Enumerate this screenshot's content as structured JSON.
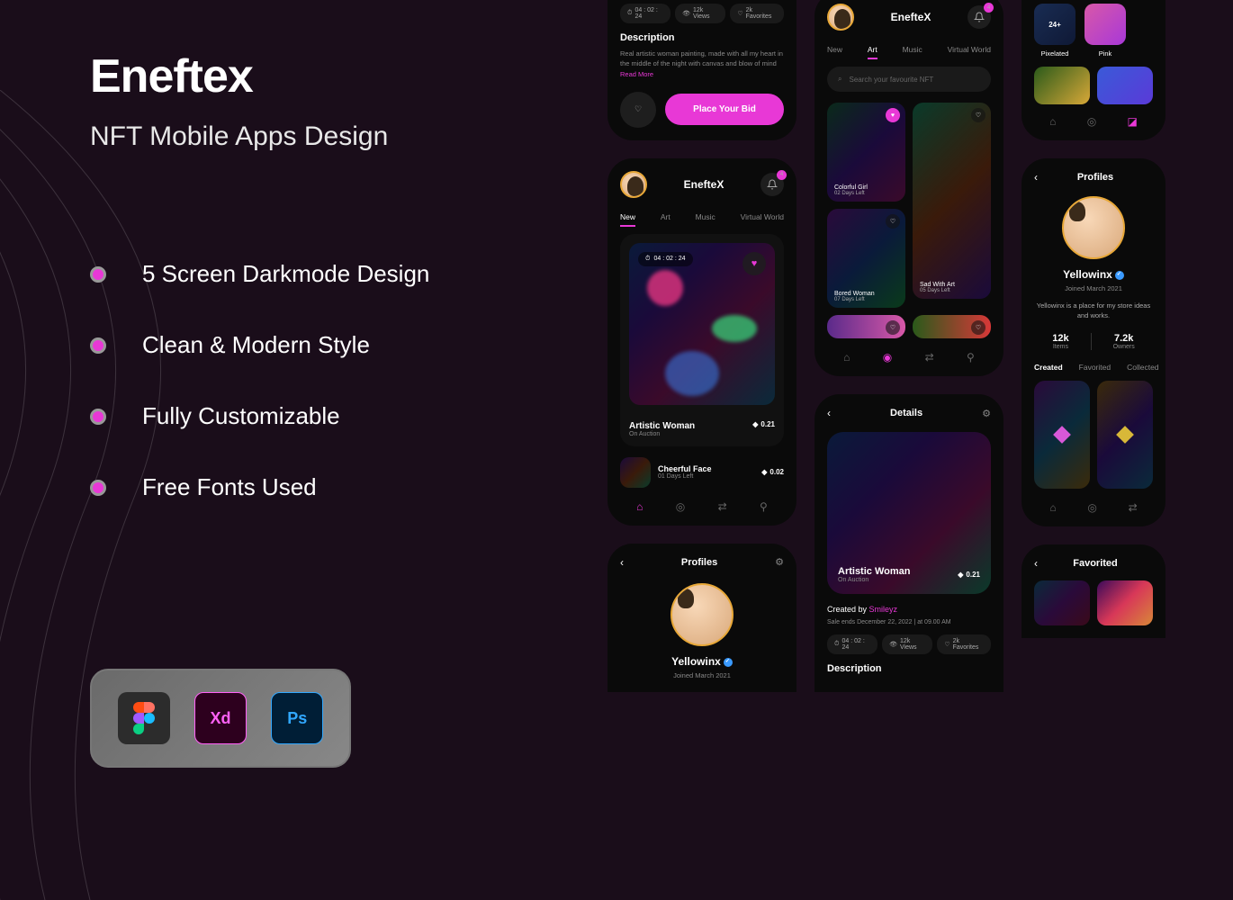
{
  "hero": {
    "title": "Eneftex",
    "subtitle": "NFT Mobile Apps Design",
    "features": [
      "5 Screen Darkmode Design",
      "Clean & Modern Style",
      "Fully Customizable",
      "Free Fonts Used"
    ],
    "tools": {
      "xd": "Xd",
      "ps": "Ps"
    }
  },
  "detail_top": {
    "time": "04 : 02 : 24",
    "views": "12k Views",
    "favs": "2k Favorites",
    "desc_title": "Description",
    "desc_text": "Real artistic woman painting, made with all my heart in the middle of the night with canvas and blow of mind ",
    "read_more": "Read More",
    "bid_button": "Place Your Bid"
  },
  "home": {
    "brand": "EnefteX",
    "notif_count": "4",
    "tabs": [
      "New",
      "Art",
      "Music",
      "Virtual World"
    ],
    "card": {
      "timer": "04 : 02 : 24",
      "title": "Artistic Woman",
      "sub": "On Auction",
      "price": "0.21"
    },
    "list": {
      "title": "Cheerful Face",
      "sub": "01 Days Left",
      "price": "0.02"
    }
  },
  "art": {
    "brand": "EnefteX",
    "notif_count": "4",
    "tabs": [
      "New",
      "Art",
      "Music",
      "Virtual World"
    ],
    "search_placeholder": "Search your favourite NFT",
    "cards": [
      {
        "title": "Colorful Girl",
        "sub": "02 Days Left"
      },
      {
        "title": "Bored Woman",
        "sub": "07 Days Left"
      },
      {
        "title": "Sad With Art",
        "sub": "05 Days Left"
      }
    ]
  },
  "profile_s": {
    "header": "Profiles",
    "name": "Yellowinx",
    "joined": "Joined March 2021"
  },
  "detail_full": {
    "header": "Details",
    "title": "Artistic Woman",
    "sub": "On Auction",
    "price": "0.21",
    "created_by": "Created by ",
    "creator": "Smileyz",
    "sale_text": "Sale ends December 22, 2022   |   at 09.00 AM",
    "time": "04 : 02 : 24",
    "views": "12k Views",
    "favs": "2k Favorites",
    "desc_title": "Description"
  },
  "cat": {
    "pixelated": "Pixelated",
    "pink": "Pink",
    "plus": "24+"
  },
  "profile_r": {
    "header": "Profiles",
    "name": "Yellowinx",
    "joined": "Joined March 2021",
    "bio": "Yellowinx is a place for my store ideas and works.",
    "stats": {
      "items_n": "12k",
      "items_l": "Items",
      "owners_n": "7.2k",
      "owners_l": "Owners"
    },
    "tabs": [
      "Created",
      "Favorited",
      "Collected"
    ]
  },
  "fav": {
    "header": "Favorited"
  }
}
